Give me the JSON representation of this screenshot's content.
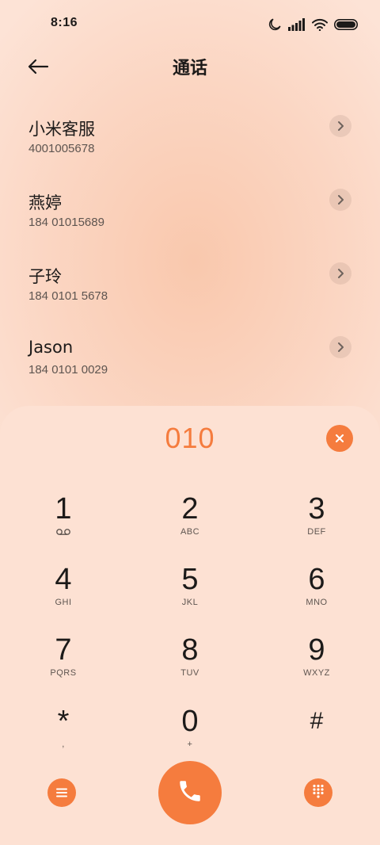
{
  "status_bar": {
    "time": "8:16",
    "icons": [
      "moon-icon",
      "signal-icon",
      "wifi-icon",
      "battery-icon"
    ]
  },
  "header": {
    "title": "通话",
    "back_icon": "arrow-left-icon"
  },
  "contacts": [
    {
      "name": "小米客服",
      "number": "4001005678"
    },
    {
      "name": "燕婷",
      "number": "184 01015689"
    },
    {
      "name": "子玲",
      "number": "184 0101 5678"
    },
    {
      "name": "Jason",
      "number": "184 0101 0029"
    }
  ],
  "dialer": {
    "number": "010",
    "keys": [
      {
        "digit": "1",
        "letters": ""
      },
      {
        "digit": "2",
        "letters": "ABC"
      },
      {
        "digit": "3",
        "letters": "DEF"
      },
      {
        "digit": "4",
        "letters": "GHI"
      },
      {
        "digit": "5",
        "letters": "JKL"
      },
      {
        "digit": "6",
        "letters": "MNO"
      },
      {
        "digit": "7",
        "letters": "PQRS"
      },
      {
        "digit": "8",
        "letters": "TUV"
      },
      {
        "digit": "9",
        "letters": "WXYZ"
      },
      {
        "digit": "*",
        "letters": ","
      },
      {
        "digit": "0",
        "letters": "+"
      },
      {
        "digit": "#",
        "letters": ""
      }
    ]
  },
  "colors": {
    "accent": "#f57c3e",
    "background": "#fde2d4",
    "text": "#1c1a19",
    "secondary_text": "#5e5550"
  }
}
